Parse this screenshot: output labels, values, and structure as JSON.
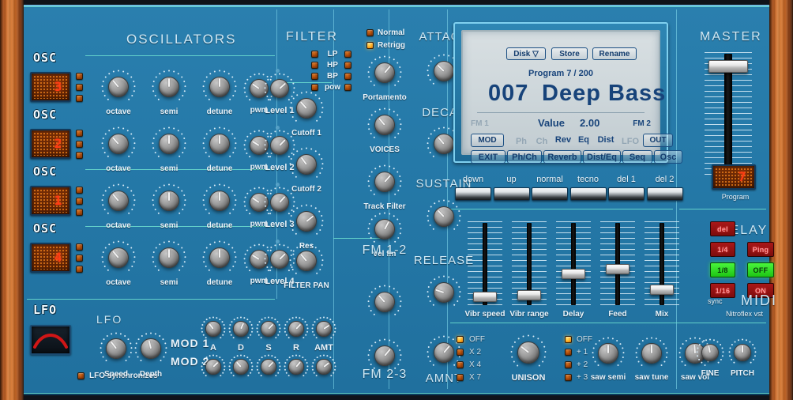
{
  "plugin": {
    "name": "Nitroflex vst",
    "midi_label": "MIDI"
  },
  "oscillators": {
    "title": "OSCILLATORS",
    "osc_tag": "OSC",
    "knob_labels": [
      "octave",
      "semi",
      "detune",
      "pwm"
    ],
    "rows": [
      {
        "tag": "OSC",
        "wave": "3",
        "level_label": "Level 1",
        "knobs": [
          {
            "label": "octave",
            "angle": -40
          },
          {
            "label": "semi",
            "angle": 0
          },
          {
            "label": "detune",
            "angle": 0
          },
          {
            "label": "pwm",
            "angle": -55
          },
          {
            "label": "Level 1",
            "angle": 48
          }
        ]
      },
      {
        "tag": "OSC",
        "wave": "2",
        "level_label": "Level 2",
        "knobs": [
          {
            "label": "octave",
            "angle": -42
          },
          {
            "label": "semi",
            "angle": 0
          },
          {
            "label": "detune",
            "angle": 0
          },
          {
            "label": "pwm",
            "angle": -58
          },
          {
            "label": "Level 2",
            "angle": 44
          }
        ]
      },
      {
        "tag": "OSC",
        "wave": "1",
        "level_label": "Level 3",
        "knobs": [
          {
            "label": "octave",
            "angle": -40
          },
          {
            "label": "semi",
            "angle": 0
          },
          {
            "label": "detune",
            "angle": 0
          },
          {
            "label": "pwm",
            "angle": -56
          },
          {
            "label": "Level 3",
            "angle": 42
          }
        ]
      },
      {
        "tag": "OSC",
        "wave": "4",
        "level_label": "Level 4",
        "knobs": [
          {
            "label": "octave",
            "angle": -40
          },
          {
            "label": "semi",
            "angle": 0
          },
          {
            "label": "detune",
            "angle": 0
          },
          {
            "label": "pwm",
            "angle": -58
          },
          {
            "label": "Level 4",
            "angle": 45
          }
        ]
      }
    ]
  },
  "lfo": {
    "tag": "LFO",
    "title": "LFO",
    "speed_label": "Speed",
    "depth_label": "Depth",
    "sync_label": "LFO synchronizes",
    "sync_led": "off",
    "mod1_label": "MOD 1",
    "mod2_label": "MOD 2",
    "speed_angle": -38,
    "depth_angle": -14,
    "env_labels": [
      "A",
      "D",
      "S",
      "R",
      "AMT"
    ],
    "mod1_angles": [
      -38,
      24,
      44,
      44,
      56
    ],
    "mod2_angles": [
      46,
      -42,
      44,
      40,
      52
    ]
  },
  "filter": {
    "title": "FILTER",
    "modes": [
      "LP",
      "HP",
      "BP",
      "pow"
    ],
    "mode_leds_left": [
      "off",
      "off",
      "off",
      "off"
    ],
    "mode_leds_right": [
      "off",
      "off",
      "off",
      "off"
    ],
    "knobs": [
      {
        "label": "Cutoff 1",
        "angle": -42
      },
      {
        "label": "Cutoff 2",
        "angle": -36
      },
      {
        "label": "Res",
        "angle": 52
      },
      {
        "label": "FILTER PAN",
        "angle": -40
      }
    ]
  },
  "voice": {
    "normal_label": "Normal",
    "retrigg_label": "Retrigg",
    "normal_led": "off",
    "retrigg_led": "on",
    "knobs": [
      {
        "label": "Portamento",
        "angle": 40
      },
      {
        "label": "VOICES",
        "angle": -40
      },
      {
        "label": "Track Filter",
        "angle": 42
      },
      {
        "label": "vel fm",
        "angle": 28
      }
    ],
    "fm": [
      {
        "label": "FM 1-2",
        "angle": -42,
        "label_top": true
      },
      {
        "label": "FM 2-3",
        "angle": 40,
        "label_top": false
      }
    ]
  },
  "envelope": {
    "stages": [
      {
        "label": "ATTACK",
        "angle": -46
      },
      {
        "label": "DECAY",
        "angle": -40
      },
      {
        "label": "SUSTAIN",
        "angle": -44
      },
      {
        "label": "RELEASE",
        "angle": -72
      },
      {
        "label": "AMNT",
        "angle": 40
      }
    ]
  },
  "lcd": {
    "top_buttons": [
      "Disk  ▽",
      "Store",
      "Rename"
    ],
    "program_line": "Program  7  /  200",
    "patch_number": "007",
    "patch_name": "Deep Bass",
    "fm1_label": "FM 1",
    "fm2_label": "FM 2",
    "value_label": "Value",
    "value": "2.00",
    "row_mod": [
      {
        "label": "MOD",
        "style": "button"
      },
      {
        "label": "Ph",
        "style": "dim"
      },
      {
        "label": "Ch",
        "style": "dim"
      },
      {
        "label": "Rev",
        "style": "text"
      },
      {
        "label": "Eq",
        "style": "text"
      },
      {
        "label": "Dist",
        "style": "text"
      },
      {
        "label": "LFO",
        "style": "dim"
      },
      {
        "label": "OUT",
        "style": "button"
      }
    ],
    "row_nav": [
      "EXIT",
      "Ph/Ch",
      "Reverb",
      "Dist/Eq",
      "Seq",
      "Osc"
    ]
  },
  "quick_buttons": [
    "down",
    "up",
    "normal",
    "tecno",
    "del 1",
    "del 2"
  ],
  "mix_sliders": [
    {
      "label": "Vibr speed",
      "value": 4
    },
    {
      "label": "Vibr range",
      "value": 6
    },
    {
      "label": "Delay",
      "value": 36
    },
    {
      "label": "Feed",
      "value": 42
    },
    {
      "label": "Mix",
      "value": 14
    }
  ],
  "master": {
    "title": "MASTER",
    "value": 93,
    "program_label": "Program",
    "program_glyph": "7"
  },
  "delay": {
    "title": "DELAY",
    "sync_label": "sync",
    "sync_buttons": [
      {
        "label": "del",
        "state": "red"
      },
      {
        "label": "1/4",
        "state": "red"
      },
      {
        "label": "1/8",
        "state": "green"
      },
      {
        "label": "1/16",
        "state": "red"
      }
    ],
    "mode_buttons": [
      {
        "label": "Ping",
        "state": "red"
      },
      {
        "label": "OFF",
        "state": "green"
      },
      {
        "label": "ON",
        "state": "red"
      }
    ]
  },
  "unison": {
    "label": "UNISON",
    "options": [
      "OFF",
      "X 2",
      "X 4",
      "X 7"
    ],
    "leds": [
      "on",
      "off",
      "off",
      "off"
    ],
    "knob_angle": -52
  },
  "saw": {
    "options": [
      "OFF",
      "+ 1",
      "+ 2",
      "+ 3"
    ],
    "leds": [
      "on",
      "off",
      "off",
      "off"
    ],
    "knobs": [
      {
        "label": "saw semi",
        "angle": 0
      },
      {
        "label": "saw tune",
        "angle": 0
      },
      {
        "label": "saw vol",
        "angle": -4
      }
    ]
  },
  "tuning": {
    "knobs": [
      {
        "label": "FINE",
        "angle": -12
      },
      {
        "label": "PITCH",
        "angle": 0
      }
    ]
  }
}
